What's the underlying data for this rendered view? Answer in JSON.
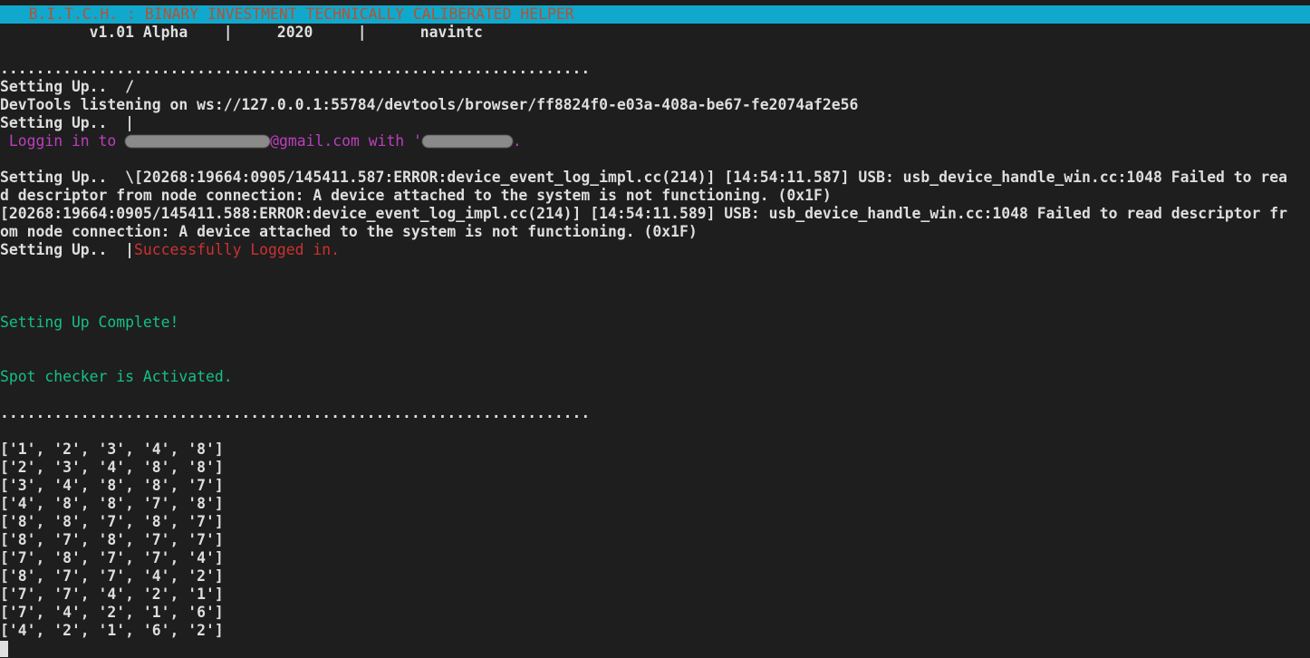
{
  "window": {
    "banner": "   B.I.T.C.H. : BINARY INVESTMENT TECHNICALLY CALIBERATED HELPER",
    "version_line": "          v1.01 Alpha    |     2020     |      navintc"
  },
  "log": {
    "separator": "..................................................................",
    "setup1": "Setting Up..  /",
    "devtools": "DevTools listening on ws://127.0.0.1:55784/devtools/browser/ff8824f0-e03a-408a-be67-fe2074af2e56",
    "setup2": "Setting Up..  |",
    "login_prefix": " Loggin in to ",
    "login_email_suffix": "@gmail.com with '",
    "login_end": ".",
    "setup3_prefix": "Setting Up..  \\",
    "error1_a": "[20268:19664:0905/145411.587:ERROR:device_event_log_impl.cc(214)] [14:54:11.587] USB: usb_device_handle_win.cc:1048 Failed to rea",
    "error1_b": "d descriptor from node connection: A device attached to the system is not functioning. (0x1F)",
    "error2_a": "[20268:19664:0905/145411.588:ERROR:device_event_log_impl.cc(214)] [14:54:11.589] USB: usb_device_handle_win.cc:1048 Failed to read descriptor fr",
    "error2_b": "om node connection: A device attached to the system is not functioning. (0x1F)",
    "setup4_prefix": "Setting Up..  |",
    "logged_in": "Successfully Logged in.",
    "setup_complete": "Setting Up Complete!",
    "spot_checker": "Spot checker is Activated."
  },
  "sequences": [
    "['1', '2', '3', '4', '8']",
    "['2', '3', '4', '8', '8']",
    "['3', '4', '8', '8', '7']",
    "['4', '8', '8', '7', '8']",
    "['8', '8', '7', '8', '7']",
    "['8', '7', '8', '7', '7']",
    "['7', '8', '7', '7', '4']",
    "['8', '7', '7', '4', '2']",
    "['7', '7', '4', '2', '1']",
    "['7', '4', '2', '1', '6']",
    "['4', '2', '1', '6', '2']"
  ]
}
